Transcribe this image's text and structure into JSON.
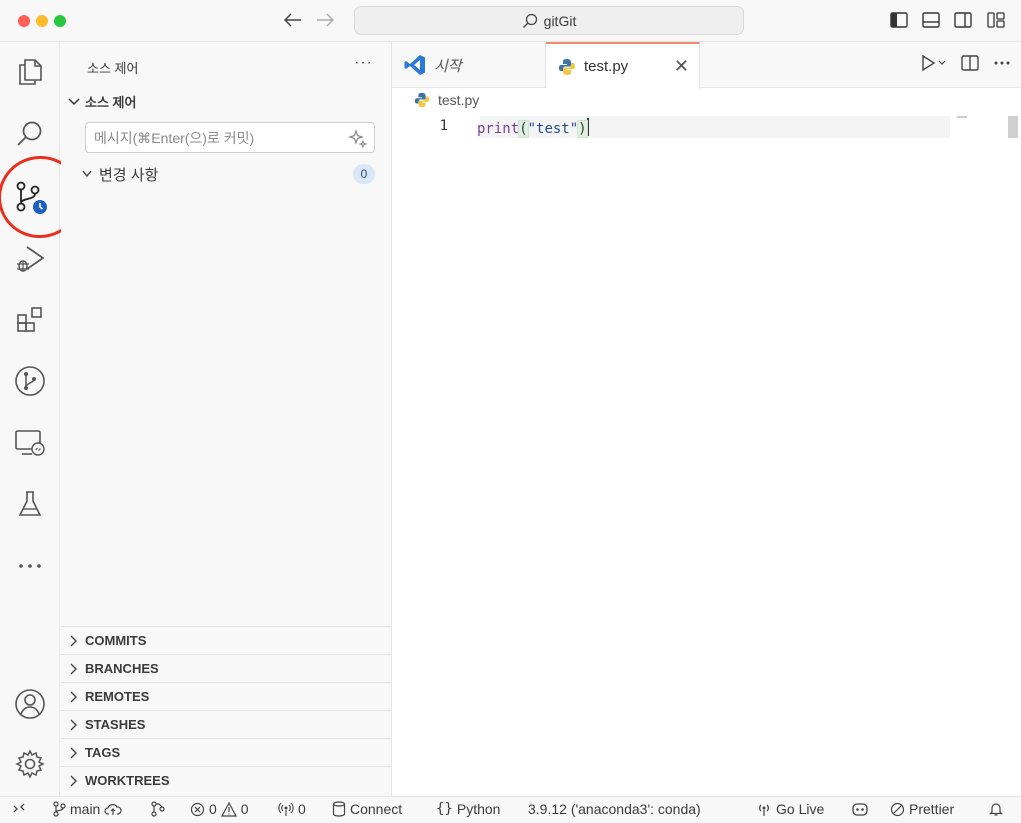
{
  "titlebar": {
    "search_text": "gitGit"
  },
  "sidebar": {
    "title": "소스 제어",
    "more": "···",
    "section_title": "소스 제어",
    "commit_placeholder": "메시지(⌘Enter(으)로 커밋)",
    "changes_label": "변경 사항",
    "changes_count": "0",
    "panels": [
      "COMMITS",
      "BRANCHES",
      "REMOTES",
      "STASHES",
      "TAGS",
      "WORKTREES"
    ]
  },
  "tabs": [
    {
      "label": "시작",
      "icon": "vscode-icon"
    },
    {
      "label": "test.py",
      "icon": "python-icon",
      "active": true
    }
  ],
  "editor": {
    "breadcrumb": "test.py",
    "line_number": "1",
    "code": {
      "fn": "print",
      "open": "(",
      "arg": "\"test\"",
      "close": ")"
    }
  },
  "statusbar": {
    "branch": "main",
    "errors": "0",
    "warnings": "0",
    "ports": "0",
    "connect": "Connect",
    "language": "Python",
    "interpreter": "3.9.12 ('anaconda3': conda)",
    "golive": "Go Live",
    "prettier": "Prettier"
  },
  "colors": {
    "accent_tab": "#f18c6b",
    "annotation_circle": "#e8301e",
    "badge_bg": "#dbe7f8"
  }
}
